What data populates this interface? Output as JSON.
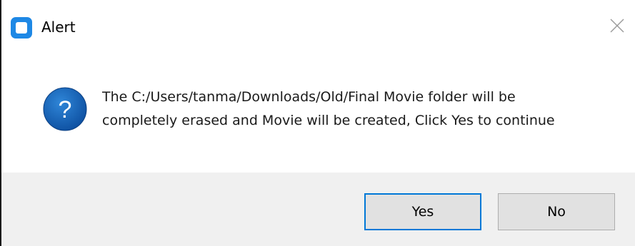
{
  "window": {
    "title": "Alert",
    "app_icon": "app-logo-icon",
    "close_icon": "close-icon"
  },
  "message": {
    "icon": "question-icon",
    "text": "The C:/Users/tanma/Downloads/Old/Final Movie folder will be\ncompletely erased and Movie will be created, Click Yes to continue"
  },
  "buttons": {
    "yes_label": "Yes",
    "no_label": "No"
  },
  "colors": {
    "accent": "#0078d7",
    "question_icon_fill": "#1565c0",
    "footer_background": "#f0f0f0",
    "button_background": "#e1e1e1"
  }
}
